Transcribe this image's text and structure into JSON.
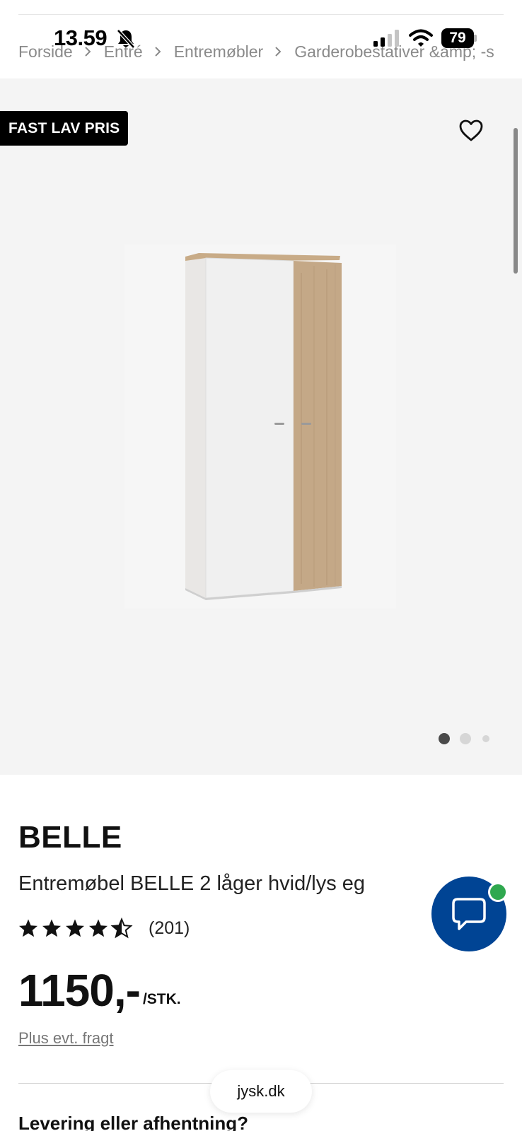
{
  "status_bar": {
    "time": "13.59",
    "battery": "79"
  },
  "breadcrumb": [
    "Forside",
    "Entré",
    "Entremøbler",
    "Garderobestativer &amp; -s"
  ],
  "gallery": {
    "badge": "FAST LAV PRIS",
    "active_slide": 1,
    "slide_count": 3
  },
  "product": {
    "brand": "BELLE",
    "name": "Entremøbel BELLE 2 låger hvid/lys eg",
    "rating": 4.5,
    "review_count": "(201)",
    "price": "1150,-",
    "price_unit": "/STK.",
    "freight_link": "Plus evt. fragt"
  },
  "delivery": {
    "heading": "Levering eller afhentning?"
  },
  "browser": {
    "url": "jysk.dk"
  },
  "colors": {
    "chat_button": "#004494",
    "online_indicator": "#2fa84f",
    "badge_bg": "#000000"
  }
}
